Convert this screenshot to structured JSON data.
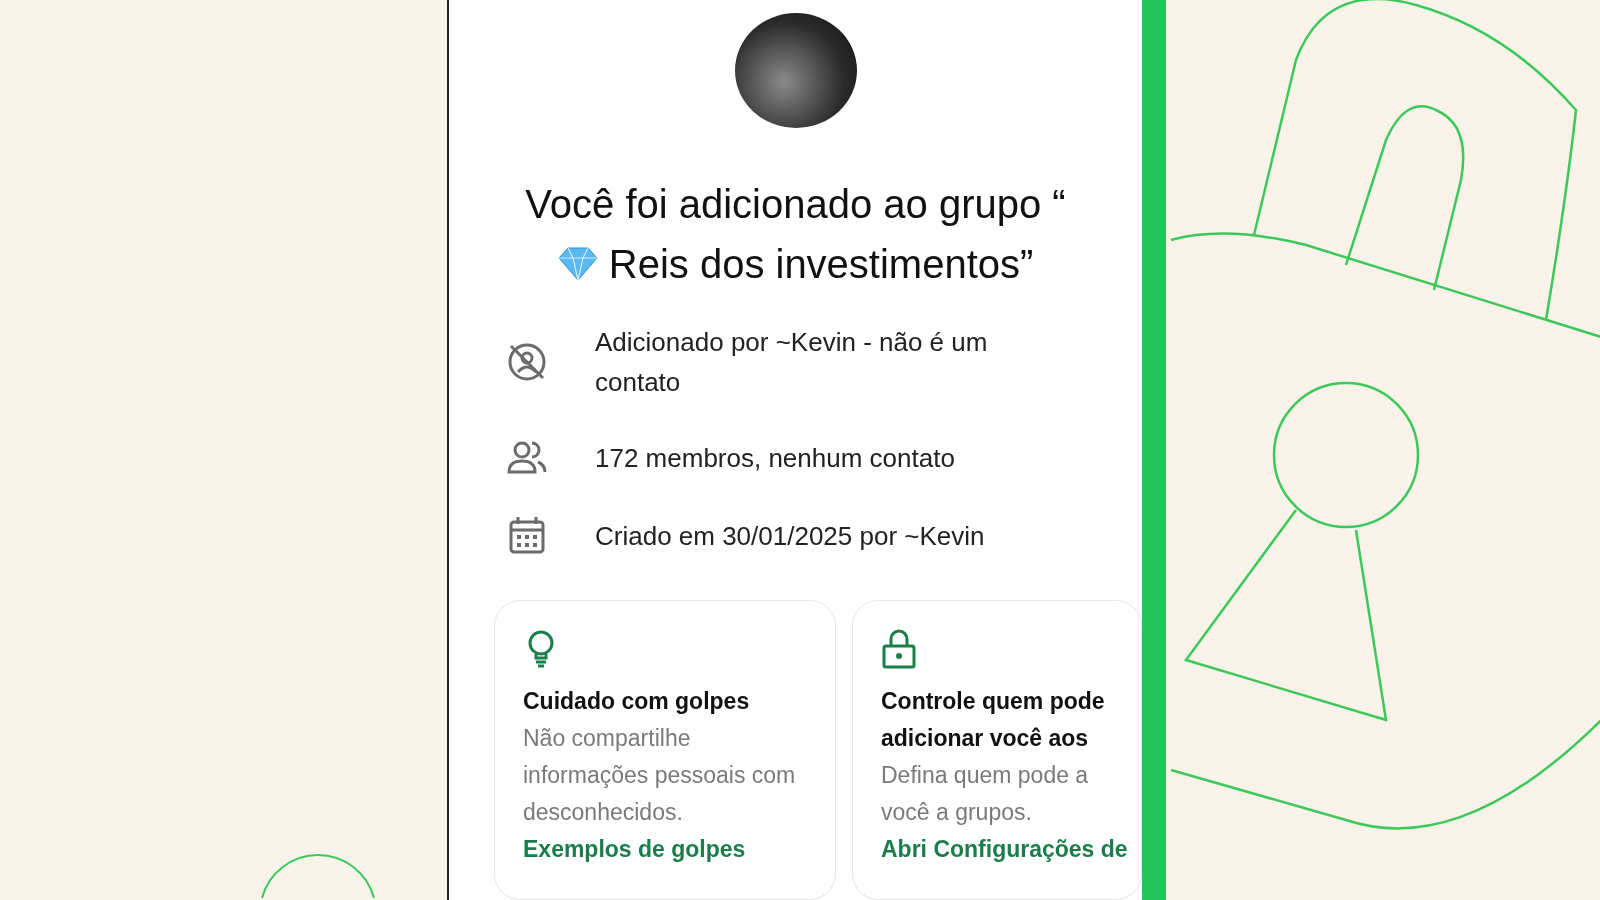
{
  "title": {
    "before_icon": "Você foi adicionado ao grupo “",
    "after_icon": "Reis dos investimentos”"
  },
  "info_rows": [
    {
      "kind": "not_contact",
      "text": "Adicionado por ~Kevin - não é um contato"
    },
    {
      "kind": "members",
      "text": "172 membros, nenhum contato"
    },
    {
      "kind": "created",
      "text": "Criado em 30/01/2025 por ~Kevin"
    }
  ],
  "cards": [
    {
      "kind": "tip",
      "title": "Cuidado com golpes",
      "text": "Não compartilhe informações pessoais com desconhecidos.",
      "link": "Exemplos de golpes"
    },
    {
      "kind": "lock",
      "title": "Controle quem pode adicionar você aos",
      "text": "Defina quem pode a você a grupos.",
      "link": "Abri Configurações de"
    }
  ]
}
